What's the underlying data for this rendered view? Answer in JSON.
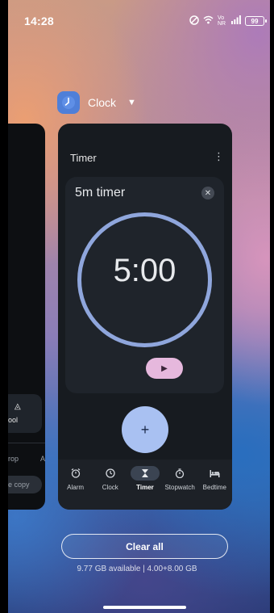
{
  "status_bar": {
    "time": "14:28",
    "network_label": "Vo NR",
    "battery": "99"
  },
  "app": {
    "name": "Clock",
    "icon": "clock-icon"
  },
  "left_card": {
    "tile_label": "ool",
    "row_left": "rop",
    "row_right": "A",
    "chip_label": "e copy"
  },
  "timer_card": {
    "title": "Timer",
    "menu_glyph": "⋮",
    "timer_name": "5m timer",
    "time_remaining": "5:00",
    "fab_glyph": "+",
    "play_glyph": "▶"
  },
  "nav": {
    "items": [
      {
        "label": "Alarm",
        "icon": "alarm-icon",
        "glyph": "⏰"
      },
      {
        "label": "Clock",
        "icon": "clock-icon",
        "glyph": "🕒"
      },
      {
        "label": "Timer",
        "icon": "hourglass-icon",
        "glyph": "⌛"
      },
      {
        "label": "Stopwatch",
        "icon": "stopwatch-icon",
        "glyph": "⏱"
      },
      {
        "label": "Bedtime",
        "icon": "bed-icon",
        "glyph": "🛏"
      }
    ],
    "active": "Timer"
  },
  "footer": {
    "clear_all": "Clear all",
    "storage": "9.77 GB available | 4.00+8.00 GB"
  },
  "colors": {
    "accent_ring": "#8fa6dc",
    "fab": "#a9c1f2",
    "play_button": "#e6b8dd",
    "card_bg": "#171b20"
  }
}
